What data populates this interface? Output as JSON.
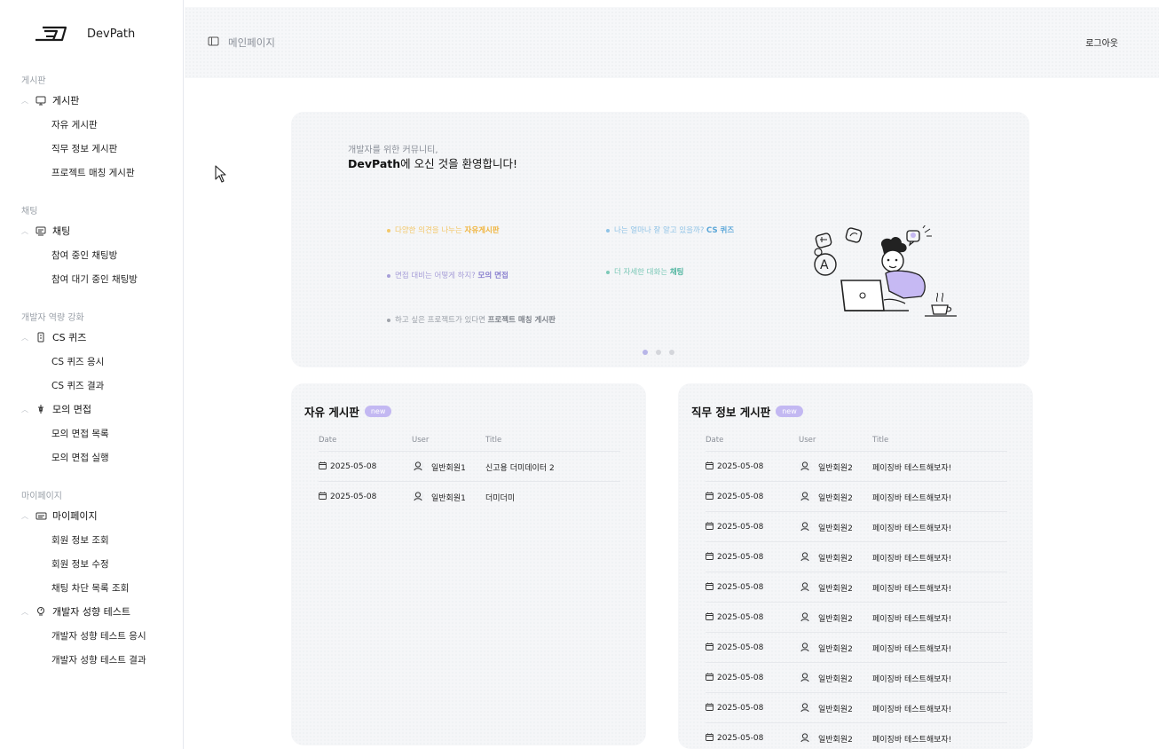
{
  "brand": {
    "name": "DevPath"
  },
  "sidebar": {
    "groups": [
      {
        "title": "게시판",
        "parent": {
          "label": "게시판",
          "icon": "monitor-icon"
        },
        "children": [
          "자유 게시판",
          "직무 정보 게시판",
          "프로젝트 매칭 게시판"
        ]
      },
      {
        "title": "채팅",
        "parent": {
          "label": "채팅",
          "icon": "chat-icon"
        },
        "children": [
          "참여 중인 채팅방",
          "참여 대기 중인 채팅방"
        ]
      },
      {
        "title": "개발자 역량 강화",
        "parents": [
          {
            "label": "CS 퀴즈",
            "icon": "quiz-icon",
            "children": [
              "CS 퀴즈 응시",
              "CS 퀴즈 결과"
            ]
          },
          {
            "label": "모의 면접",
            "icon": "interview-icon",
            "children": [
              "모의 면접 목록",
              "모의 면접 실행"
            ]
          }
        ]
      },
      {
        "title": "마이페이지",
        "parents": [
          {
            "label": "마이페이지",
            "icon": "profile-card-icon",
            "children": [
              "회원 정보 조회",
              "회원 정보 수정",
              "채팅 차단 목록 조회"
            ]
          },
          {
            "label": "개발자 성향 테스트",
            "icon": "test-icon",
            "children": [
              "개발자 성향 테스트 응시",
              "개발자 성향 테스트 결과"
            ]
          }
        ]
      }
    ]
  },
  "header": {
    "title": "메인페이지",
    "logout": "로그아웃"
  },
  "hero": {
    "sub": "개발자를 위한 커뮤니티,",
    "title_brand": "DevPath",
    "title_rest": "에 오신 것을 환영합니다!",
    "items": [
      {
        "text": "다양한 의견을 나누는 ",
        "highlight": "자유게시판",
        "color": "#f3c86a"
      },
      {
        "text": "나는 얼마나 잘 알고 있을까? ",
        "highlight": "CS 퀴즈",
        "color": "#8fc3e6"
      },
      {
        "text": "면접 대비는 어떻게 하지? ",
        "highlight": "모의 면접",
        "color": "#a79fd8"
      },
      {
        "text": "더 자세한 대화는 ",
        "highlight": "채팅",
        "color": "#7dc9b8"
      },
      {
        "text": "하고 싶은 프로젝트가 있다면 ",
        "highlight": "프로젝트 매칭 게시판",
        "color": "#a0a4ab"
      }
    ],
    "slide_count": 3,
    "active_slide": 1
  },
  "boards": {
    "free": {
      "title": "자유 게시판",
      "badge": "new",
      "columns": [
        "Date",
        "User",
        "Title"
      ],
      "rows": [
        {
          "date": "2025-05-08",
          "user": "일반회원1",
          "title": "신고용 더미데이터 2"
        },
        {
          "date": "2025-05-08",
          "user": "일반회원1",
          "title": "더미더미"
        }
      ]
    },
    "job": {
      "title": "직무 정보 게시판",
      "badge": "new",
      "columns": [
        "Date",
        "User",
        "Title"
      ],
      "rows": [
        {
          "date": "2025-05-08",
          "user": "일반회원2",
          "title": "페이징바 테스트해보자!"
        },
        {
          "date": "2025-05-08",
          "user": "일반회원2",
          "title": "페이징바 테스트해보자!"
        },
        {
          "date": "2025-05-08",
          "user": "일반회원2",
          "title": "페이징바 테스트해보자!"
        },
        {
          "date": "2025-05-08",
          "user": "일반회원2",
          "title": "페이징바 테스트해보자!"
        },
        {
          "date": "2025-05-08",
          "user": "일반회원2",
          "title": "페이징바 테스트해보자!"
        },
        {
          "date": "2025-05-08",
          "user": "일반회원2",
          "title": "페이징바 테스트해보자!"
        },
        {
          "date": "2025-05-08",
          "user": "일반회원2",
          "title": "페이징바 테스트해보자!"
        },
        {
          "date": "2025-05-08",
          "user": "일반회원2",
          "title": "페이징바 테스트해보자!"
        },
        {
          "date": "2025-05-08",
          "user": "일반회원2",
          "title": "페이징바 테스트해보자!"
        },
        {
          "date": "2025-05-08",
          "user": "일반회원2",
          "title": "페이징바 테스트해보자!"
        }
      ]
    }
  },
  "colors": {
    "accent": "#c3b8f2",
    "hero_bg": "#f5f6f8",
    "border": "#e6e8ec"
  }
}
